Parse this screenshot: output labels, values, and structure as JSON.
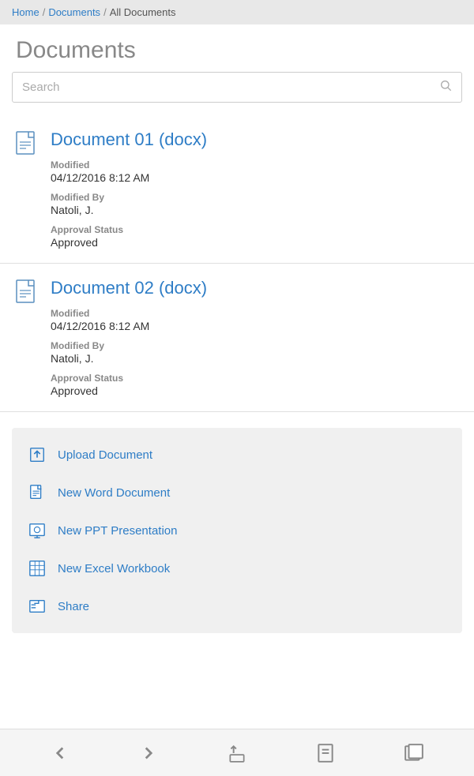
{
  "breadcrumb": {
    "home_label": "Home",
    "documents_label": "Documents",
    "current_label": "All Documents"
  },
  "page": {
    "title": "Documents"
  },
  "search": {
    "placeholder": "Search"
  },
  "documents": [
    {
      "title": "Document 01 (docx)",
      "modified_label": "Modified",
      "modified_value": "04/12/2016 8:12 AM",
      "modified_by_label": "Modified By",
      "modified_by_value": "Natoli, J.",
      "approval_label": "Approval Status",
      "approval_value": "Approved"
    },
    {
      "title": "Document 02 (docx)",
      "modified_label": "Modified",
      "modified_value": "04/12/2016 8:12 AM",
      "modified_by_label": "Modified By",
      "modified_by_value": "Natoli, J.",
      "approval_label": "Approval Status",
      "approval_value": "Approved"
    }
  ],
  "actions": [
    {
      "id": "upload",
      "label": "Upload Document",
      "icon": "upload-icon"
    },
    {
      "id": "new-word",
      "label": "New Word Document",
      "icon": "word-icon"
    },
    {
      "id": "new-ppt",
      "label": "New PPT Presentation",
      "icon": "ppt-icon"
    },
    {
      "id": "new-excel",
      "label": "New Excel Workbook",
      "icon": "excel-icon"
    },
    {
      "id": "share",
      "label": "Share",
      "icon": "share-icon"
    }
  ],
  "toolbar": {
    "back_label": "‹",
    "forward_label": "›"
  }
}
